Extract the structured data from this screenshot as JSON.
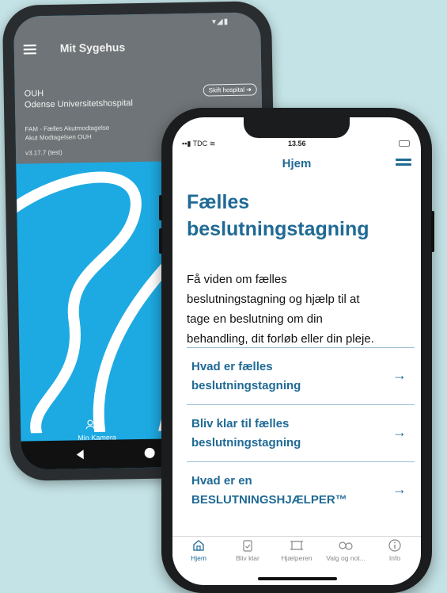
{
  "android": {
    "status": "▾◢▮",
    "app_title": "Mit Sygehus",
    "hospital_short": "OUH",
    "hospital_name": "Odense Universitetshospital",
    "switch_button": "Skift hospital ➔",
    "department_line1": "FAM - Fælles Akutmodtagelse",
    "department_line2": "Akut Modtagelsen OUH",
    "version": "v3.17.7 (test)",
    "bottom_tab_label": "Min Kamera"
  },
  "iphone": {
    "status": {
      "carrier": "TDC",
      "time": "13.56"
    },
    "header_title": "Hjem",
    "heading_line1": "Fælles",
    "heading_line2": "beslutningstagning",
    "intro_line1": "Få viden om fælles",
    "intro_line2": "beslutningstagning og hjælp til at",
    "intro_line3": "tage en beslutning om din",
    "intro_line4": "behandling, dit forløb eller din pleje.",
    "links": [
      {
        "line1": "Hvad er fælles",
        "line2": "beslutningstagning",
        "arrow": "→"
      },
      {
        "line1": "Bliv klar til fælles",
        "line2": "beslutningstagning",
        "arrow": "→"
      },
      {
        "line1": "Hvad er en",
        "line2": "BESLUTNINGSHJÆLPER™",
        "arrow": "→"
      }
    ],
    "tabs": [
      {
        "label": "Hjem",
        "icon": "home-icon"
      },
      {
        "label": "Bliv klar",
        "icon": "clipboard-icon"
      },
      {
        "label": "Hjælperen",
        "icon": "helper-icon"
      },
      {
        "label": "Valg og not...",
        "icon": "choices-icon"
      },
      {
        "label": "Info",
        "icon": "info-icon"
      }
    ]
  },
  "colors": {
    "background": "#c4e3e6",
    "brand_blue": "#1f6a95",
    "android_header": "#6e7477",
    "android_art": "#1daae2"
  }
}
